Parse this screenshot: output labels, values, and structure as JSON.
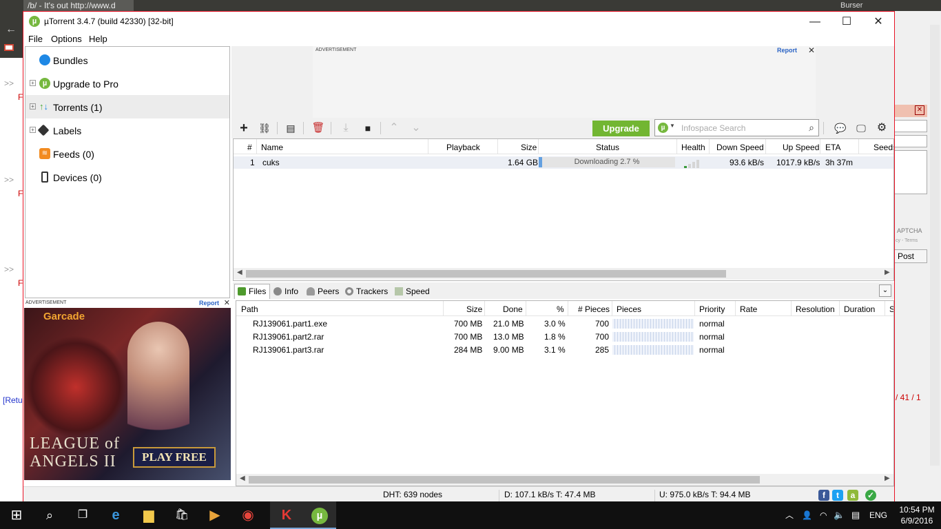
{
  "browser_bg": {
    "tab_title": "/b/ - It's out http://www.d",
    "top_right_label": "Burser",
    "left_fragments": [
      ">>",
      "F",
      ">>",
      "F",
      ">>",
      "F"
    ],
    "return_link": "[Retu",
    "right_fragments": {
      "captcha": "APTCHA",
      "privacy": "cy - Terms",
      "post": "Post",
      "pages": "/ 41 / 1"
    }
  },
  "window": {
    "title": "µTorrent 3.4.7  (build 42330) [32-bit]",
    "controls": {
      "minimize": "—",
      "maximize": "☐",
      "close": "✕"
    }
  },
  "menu": [
    "File",
    "Options",
    "Help"
  ],
  "sidebar": {
    "items": [
      {
        "label": "Bundles",
        "icon": "bundles-icon",
        "expander": false,
        "selected": false
      },
      {
        "label": "Upgrade to Pro",
        "icon": "utorrent-icon",
        "expander": true,
        "selected": false
      },
      {
        "label": "Torrents (1)",
        "icon": "torrents-icon",
        "expander": true,
        "selected": true
      },
      {
        "label": "Labels",
        "icon": "label-icon",
        "expander": true,
        "selected": false
      },
      {
        "label": "Feeds (0)",
        "icon": "rss-icon",
        "expander": false,
        "selected": false
      },
      {
        "label": "Devices (0)",
        "icon": "device-icon",
        "expander": false,
        "selected": false
      }
    ]
  },
  "ads": {
    "label": "ADVERTISEMENT",
    "report": "Report",
    "close": "✕",
    "left_ad": {
      "brand": "arcade",
      "title_line1": "LEAGUE of",
      "title_line2": "ANGELS II",
      "cta": "PLAY FREE"
    }
  },
  "toolbar": {
    "upgrade_label": "Upgrade",
    "search_placeholder": "Infospace Search"
  },
  "torrent_list": {
    "columns": [
      "#",
      "Name",
      "Playback",
      "Size",
      "Status",
      "Health",
      "Down Speed",
      "Up Speed",
      "ETA",
      "Seeds"
    ],
    "rows": [
      {
        "num": "1",
        "name": "cuks",
        "playback": "",
        "size": "1.64 GB",
        "status": "Downloading 2.7 %",
        "progress": 0.027,
        "health_bars": 1,
        "down_speed": "93.6 kB/s",
        "up_speed": "1017.9 kB/s",
        "eta": "3h 37m",
        "seeds": ""
      }
    ]
  },
  "detail_tabs": [
    {
      "label": "Files",
      "icon": "files-icon",
      "active": true
    },
    {
      "label": "Info",
      "icon": "info-icon",
      "active": false
    },
    {
      "label": "Peers",
      "icon": "peers-icon",
      "active": false
    },
    {
      "label": "Trackers",
      "icon": "trackers-icon",
      "active": false
    },
    {
      "label": "Speed",
      "icon": "speed-icon",
      "active": false
    }
  ],
  "files": {
    "columns": [
      "Path",
      "Size",
      "Done",
      "%",
      "# Pieces",
      "Pieces",
      "Priority",
      "Rate",
      "Resolution",
      "Duration",
      "S"
    ],
    "rows": [
      {
        "path": "RJ139061.part1.exe",
        "size": "700 MB",
        "done": "21.0 MB",
        "pct": "3.0 %",
        "pieces_count": "700",
        "priority": "normal"
      },
      {
        "path": "RJ139061.part2.rar",
        "size": "700 MB",
        "done": "13.0 MB",
        "pct": "1.8 %",
        "pieces_count": "700",
        "priority": "normal"
      },
      {
        "path": "RJ139061.part3.rar",
        "size": "284 MB",
        "done": "9.00 MB",
        "pct": "3.1 %",
        "pieces_count": "285",
        "priority": "normal"
      }
    ]
  },
  "statusbar": {
    "dht": "DHT: 639 nodes",
    "download": "D: 107.1 kB/s T: 47.4 MB",
    "upload": "U: 975.0 kB/s T: 94.4 MB"
  },
  "taskbar": {
    "lang": "ENG",
    "time": "10:54 PM",
    "date": "6/9/2016"
  },
  "colors": {
    "accent_green": "#72b632",
    "window_border": "#e81123",
    "link_blue": "#2a63c5"
  }
}
